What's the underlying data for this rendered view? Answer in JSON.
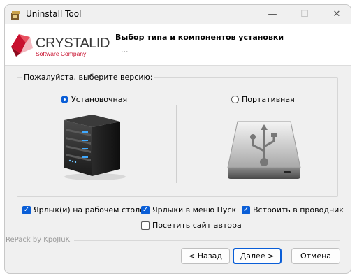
{
  "window": {
    "title": "Uninstall Tool",
    "controls": [
      "—",
      "☐",
      "✕"
    ]
  },
  "header": {
    "logo_name": "CRYSTALIDEA",
    "logo_sub": "Software Company",
    "title": "Выбор типа и компонентов установки",
    "subtitle": "..."
  },
  "version_group": {
    "label": "Пожалуйста, выберите версию:",
    "options": [
      {
        "label": "Установочная",
        "selected": true,
        "icon": "server-icon"
      },
      {
        "label": "Портативная",
        "selected": false,
        "icon": "usb-drive-icon"
      }
    ]
  },
  "checkboxes": [
    {
      "label": "Ярлык(и) на рабочем столе",
      "checked": true
    },
    {
      "label": "Ярлыки в меню Пуск",
      "checked": true
    },
    {
      "label": "Встроить в проводник",
      "checked": true
    },
    {
      "label": "Посетить сайт автора",
      "checked": false
    }
  ],
  "footer": {
    "repack": "RePack by KpoJIuK"
  },
  "buttons": {
    "back": "< Назад",
    "next": "Далее >",
    "cancel": "Отмена"
  },
  "colors": {
    "accent": "#0a5ed7",
    "logo_red": "#c8102e",
    "logo_text": "#3a3a3a"
  }
}
